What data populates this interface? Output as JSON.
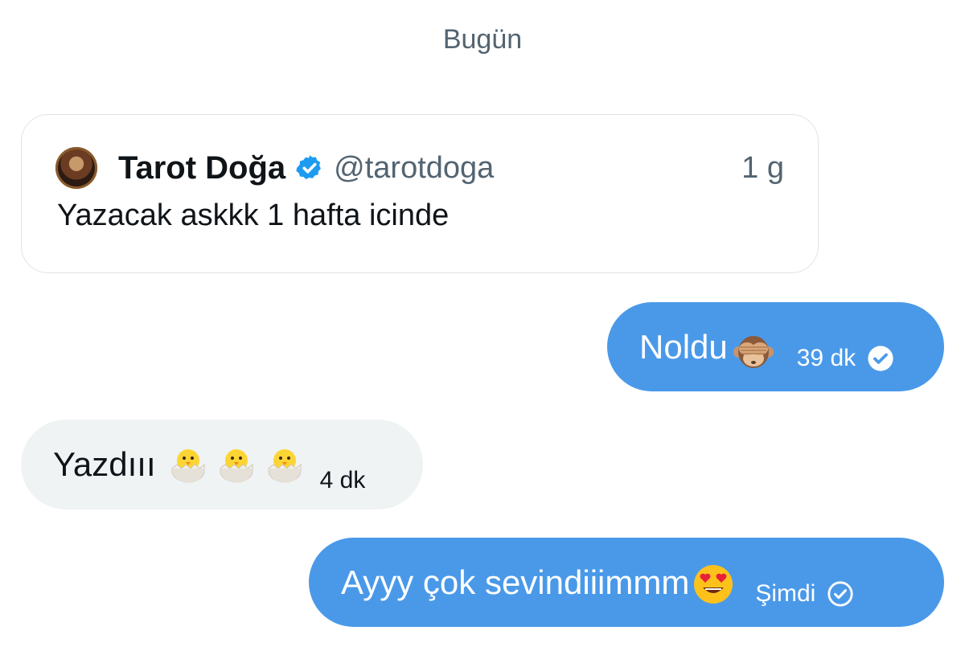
{
  "date_separator": "Bugün",
  "quote": {
    "name": "Tarot Doğa",
    "handle": "@tarotdoga",
    "time": "1 g",
    "text": "Yazacak askkk 1 hafta icinde",
    "verified": true
  },
  "messages": [
    {
      "direction": "outgoing",
      "text": "Noldu",
      "emoji": "see-no-evil-monkey",
      "time": "39 dk",
      "status": "read"
    },
    {
      "direction": "incoming",
      "text": "Yazdııı",
      "emoji": "hatching-chick x3",
      "time": "4 dk"
    },
    {
      "direction": "outgoing",
      "text": "Ayyy çok sevindiiimmm",
      "emoji": "smiling-face-with-heart-eyes",
      "time": "Şimdi",
      "status": "sent"
    }
  ],
  "colors": {
    "outgoing_bubble": "#4a99e9",
    "incoming_bubble": "#eff3f4",
    "verified_badge": "#1d9bf0",
    "secondary_text": "#536471"
  }
}
